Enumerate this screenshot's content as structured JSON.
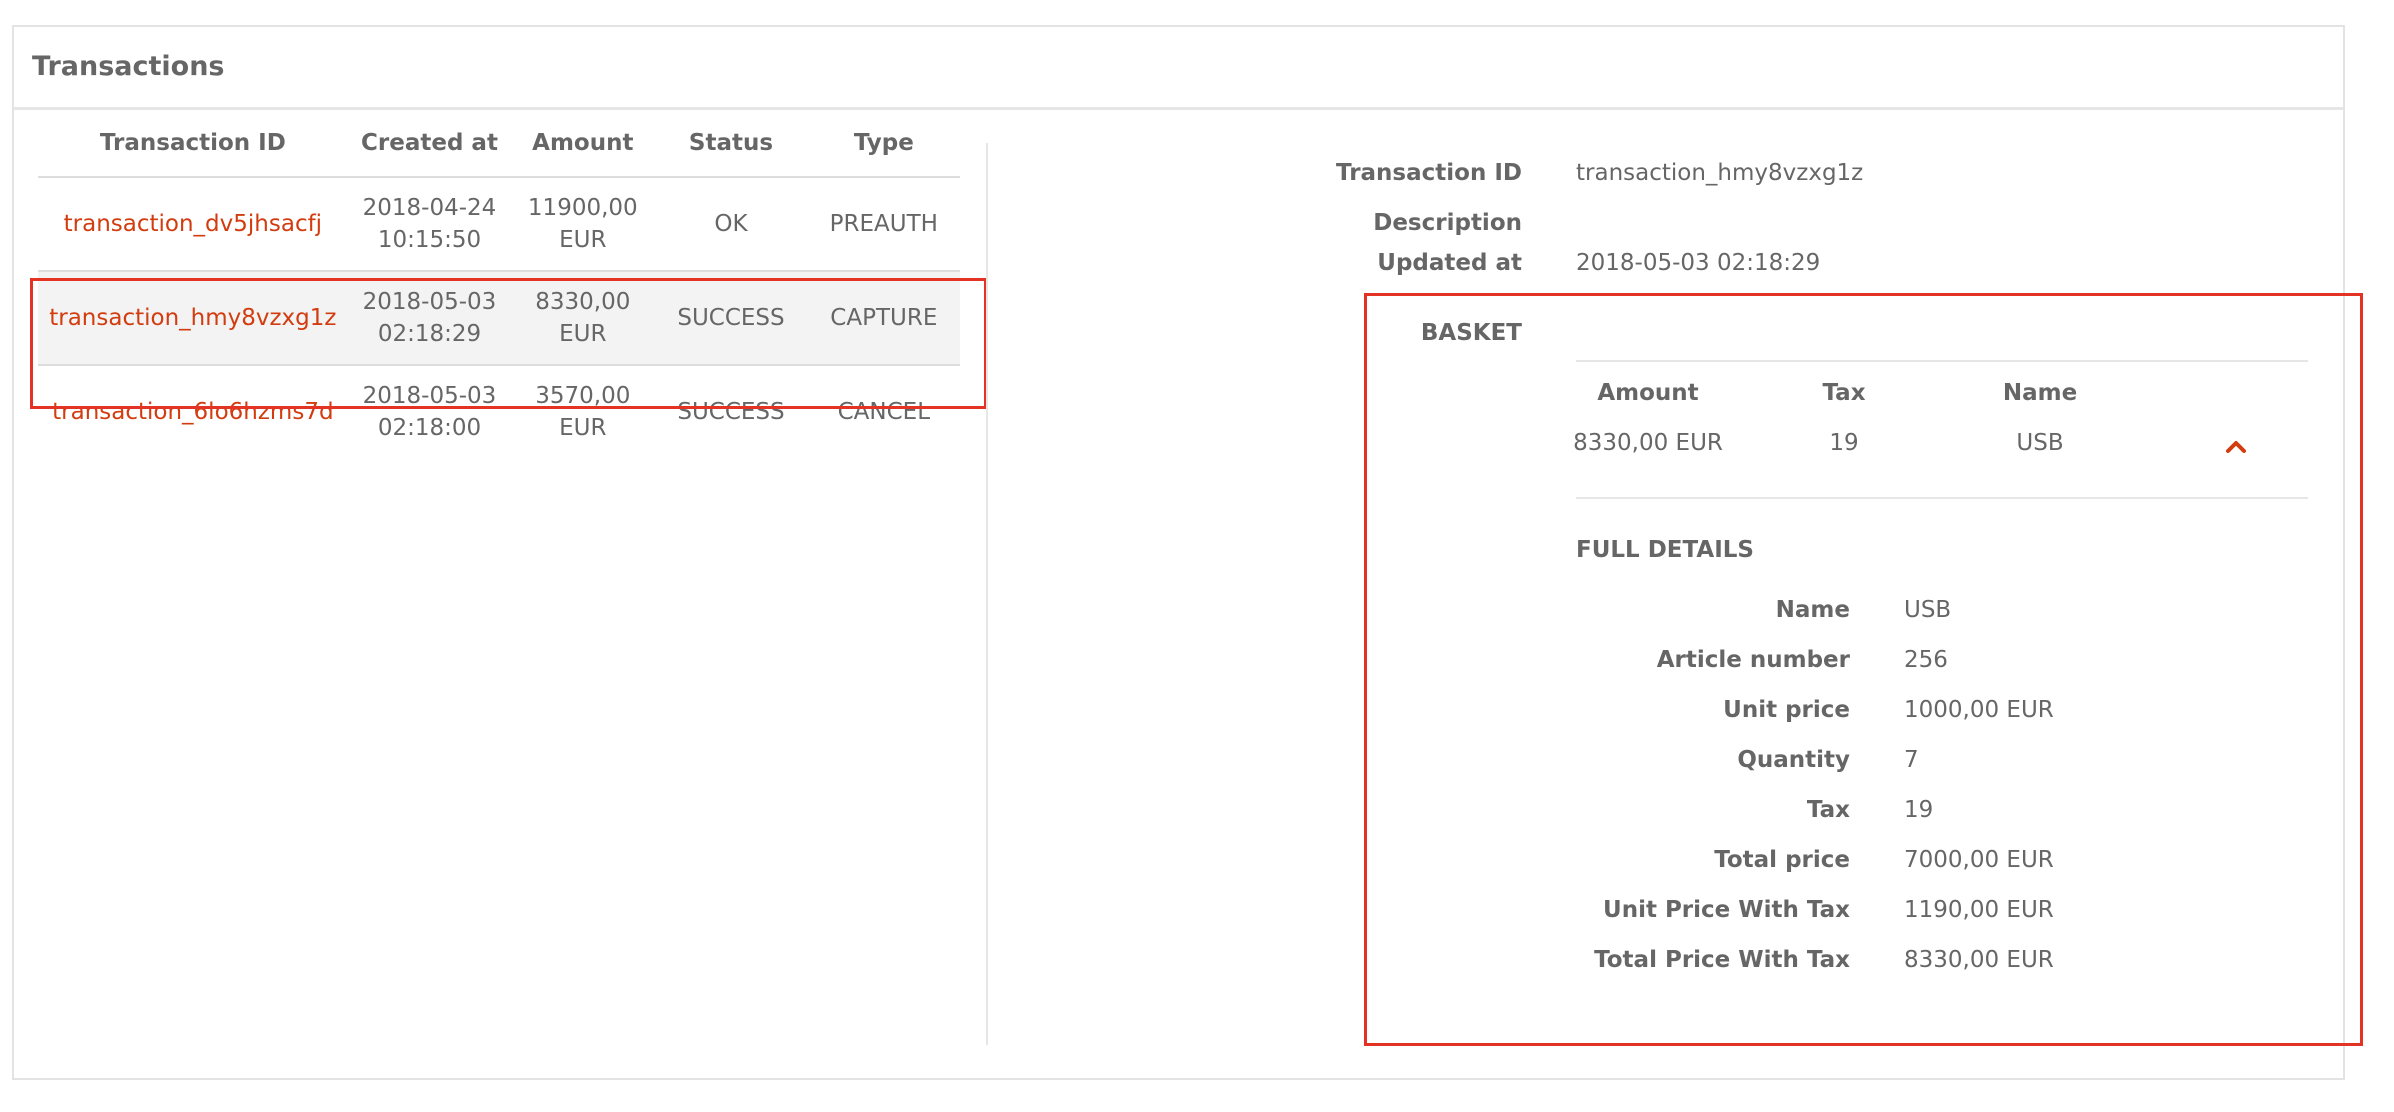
{
  "panel": {
    "title": "Transactions"
  },
  "table": {
    "headers": [
      "Transaction ID",
      "Created at",
      "Amount",
      "Status",
      "Type"
    ],
    "rows": [
      {
        "id": "transaction_dv5jhsacfj",
        "created_date": "2018-04-24",
        "created_time": "10:15:50",
        "amount_value": "11900,00",
        "amount_currency": "EUR",
        "status": "OK",
        "type": "PREAUTH"
      },
      {
        "id": "transaction_hmy8vzxg1z",
        "created_date": "2018-05-03",
        "created_time": "02:18:29",
        "amount_value": "8330,00",
        "amount_currency": "EUR",
        "status": "SUCCESS",
        "type": "CAPTURE"
      },
      {
        "id": "transaction_6lo6hzms7d",
        "created_date": "2018-05-03",
        "created_time": "02:18:00",
        "amount_value": "3570,00",
        "amount_currency": "EUR",
        "status": "SUCCESS",
        "type": "CANCEL"
      }
    ]
  },
  "detail": {
    "transaction_id_label": "Transaction ID",
    "transaction_id_value": "transaction_hmy8vzxg1z",
    "description_label": "Description",
    "updated_label": "Updated at",
    "updated_value": "2018-05-03 02:18:29",
    "basket_label": "BASKET",
    "basket": {
      "headers": [
        "Amount",
        "Tax",
        "Name"
      ],
      "row": {
        "amount": "8330,00 EUR",
        "tax": "19",
        "name": "USB"
      },
      "toggle_icon": "chevron-up-icon"
    },
    "full_details_title": "FULL DETAILS",
    "full_details": [
      {
        "label": "Name",
        "value": "USB"
      },
      {
        "label": "Article number",
        "value": "256"
      },
      {
        "label": "Unit price",
        "value": "1000,00 EUR"
      },
      {
        "label": "Quantity",
        "value": "7"
      },
      {
        "label": "Tax",
        "value": "19"
      },
      {
        "label": "Total price",
        "value": "7000,00 EUR"
      },
      {
        "label": "Unit Price With Tax",
        "value": "1190,00 EUR"
      },
      {
        "label": "Total Price With Tax",
        "value": "8330,00 EUR"
      }
    ]
  },
  "colors": {
    "accent": "#d23c0f",
    "highlight": "#e23325"
  }
}
